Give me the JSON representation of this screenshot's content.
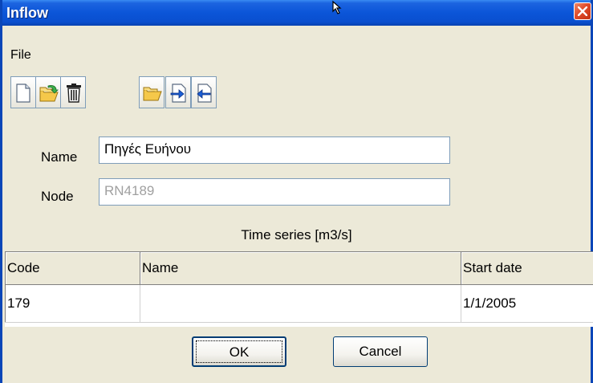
{
  "window": {
    "title": "Inflow",
    "close_icon": "close-icon"
  },
  "menu": {
    "file": "File"
  },
  "toolbar": {
    "buttons": [
      {
        "icon": "new-document-icon"
      },
      {
        "icon": "open-folder-arrow-icon"
      },
      {
        "icon": "trash-icon"
      },
      {
        "icon": "folder-icon"
      },
      {
        "icon": "import-icon"
      },
      {
        "icon": "export-icon"
      }
    ]
  },
  "form": {
    "name_label": "Name",
    "name_value": "Πηγές Ευήνου",
    "node_label": "Node",
    "node_value": "RN4189"
  },
  "timeseries": {
    "caption": "Time series [m3/s]",
    "columns": [
      "Code",
      "Name",
      "Start date"
    ],
    "rows": [
      {
        "code": "179",
        "name": "",
        "start_date": "1/1/2005"
      }
    ]
  },
  "buttons": {
    "ok": "OK",
    "cancel": "Cancel"
  },
  "colors": {
    "titlebar": "#0b55d8",
    "window_bg": "#ece9d8",
    "close_button": "#e04b2a"
  }
}
